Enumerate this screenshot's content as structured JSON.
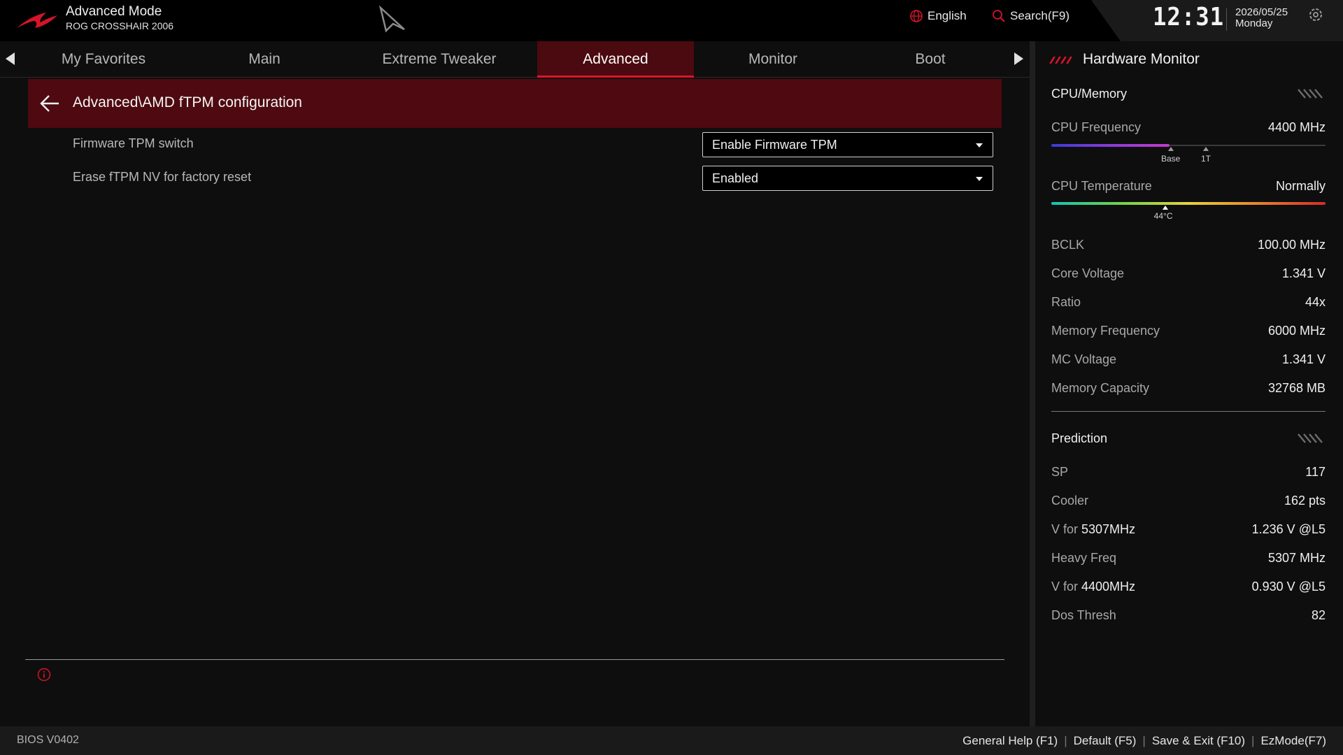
{
  "header": {
    "mode_title": "Advanced Mode",
    "board_name": "ROG CROSSHAIR 2006",
    "language": "English",
    "search": "Search(F9)",
    "time": "12:31",
    "date": "2026/05/25",
    "weekday": "Monday"
  },
  "tabs": [
    {
      "label": "My Favorites"
    },
    {
      "label": "Main"
    },
    {
      "label": "Extreme Tweaker"
    },
    {
      "label": "Advanced",
      "active": true
    },
    {
      "label": "Monitor"
    },
    {
      "label": "Boot"
    }
  ],
  "page": {
    "breadcrumb": "Advanced\\AMD fTPM configuration",
    "settings": [
      {
        "label": "Firmware TPM switch",
        "value": "Enable Firmware TPM"
      },
      {
        "label": "Erase fTPM NV for factory reset",
        "value": "Enabled"
      }
    ]
  },
  "hardware_monitor": {
    "title": "Hardware Monitor",
    "cpu_memory": {
      "heading": "CPU/Memory",
      "cpu_frequency": {
        "label": "CPU Frequency",
        "value": "4400 MHz",
        "fill_fraction": 0.43,
        "marker_base": "Base",
        "marker_1t": "1T"
      },
      "cpu_temperature": {
        "label": "CPU Temperature",
        "value": "Normally",
        "reading": "44°C",
        "level_fraction": 0.415
      },
      "rows": [
        {
          "label": "BCLK",
          "value": "100.00 MHz"
        },
        {
          "label": "Core Voltage",
          "value": "1.341 V"
        },
        {
          "label": "Ratio",
          "value": "44x"
        },
        {
          "label": "Memory Frequency",
          "value": "6000 MHz"
        },
        {
          "label": "MC Voltage",
          "value": "1.341 V"
        },
        {
          "label": "Memory Capacity",
          "value": "32768 MB"
        }
      ]
    },
    "prediction": {
      "heading": "Prediction",
      "rows": [
        {
          "label": "SP",
          "value": "117"
        },
        {
          "label": "Cooler",
          "value": "162 pts"
        },
        {
          "label_prefix": "V for ",
          "label_em": "5307MHz",
          "value": "1.236 V @L5"
        },
        {
          "label": "Heavy Freq",
          "value": "5307 MHz"
        },
        {
          "label_prefix": "V for ",
          "label_em": "4400MHz",
          "value": "0.930 V @L5"
        },
        {
          "label": "Dos Thresh",
          "value": "82"
        }
      ]
    }
  },
  "footer": {
    "bios_version": "BIOS V0402",
    "actions": [
      "General Help (F1)",
      "Default (F5)",
      "Save & Exit (F10)",
      "EzMode(F7)"
    ]
  },
  "colors": {
    "accent": "#e0132b",
    "header_band": "#4e0a10"
  },
  "icons": [
    "rog-logo-icon",
    "center-logo-icon",
    "globe-icon",
    "search-icon",
    "settings-icon",
    "back-arrow-icon",
    "info-icon"
  ]
}
